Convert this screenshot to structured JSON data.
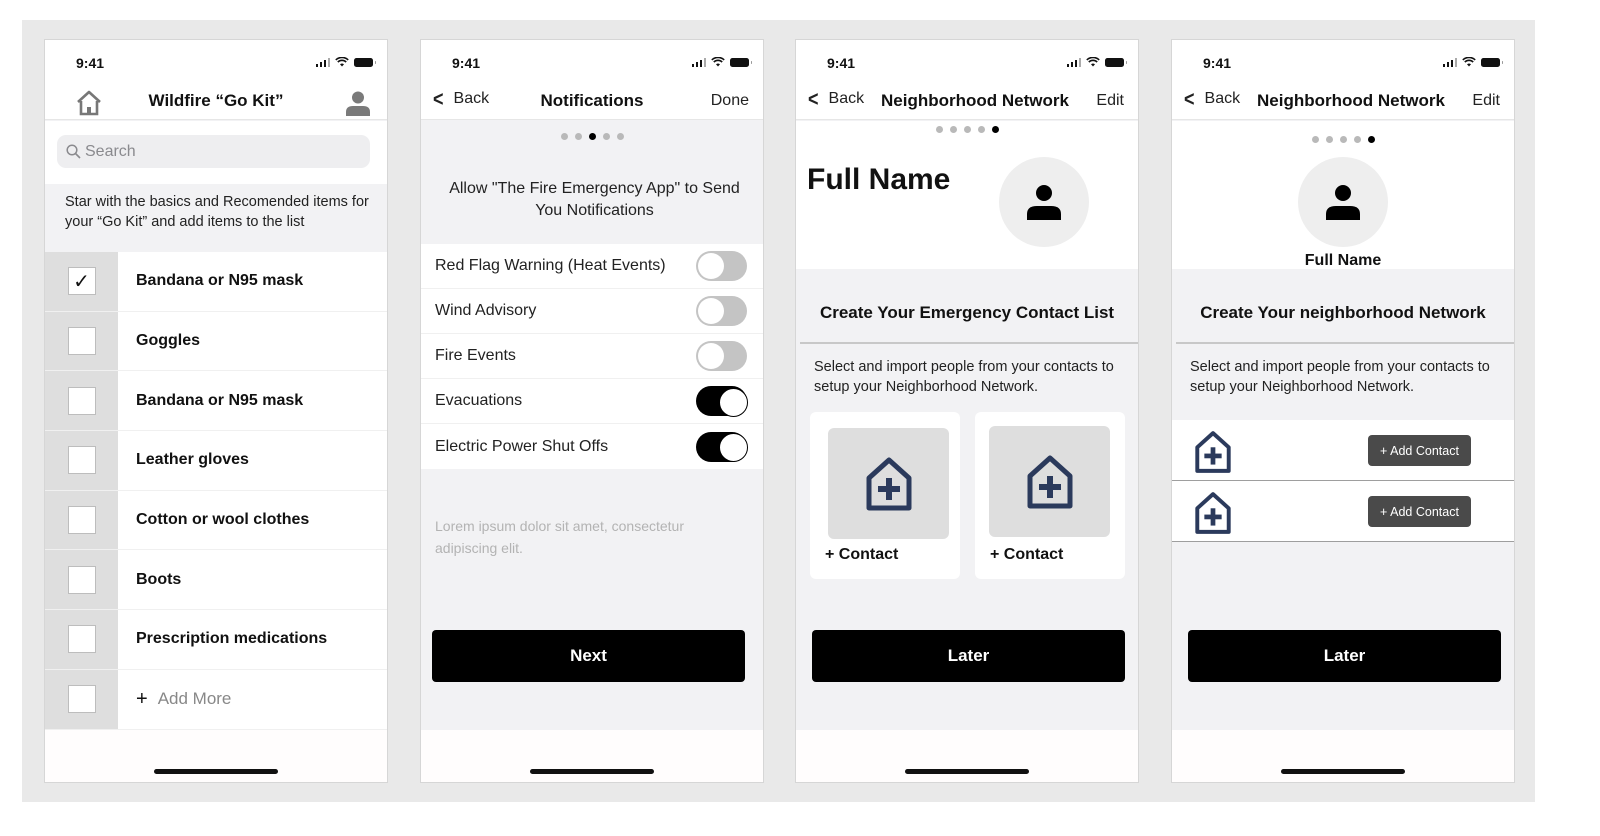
{
  "status_bar": {
    "time": "9:41"
  },
  "screens": {
    "gokit": {
      "title": "Wildfire “Go Kit”",
      "search_placeholder": "Search",
      "intro": "Star with  the basics and Recomended items for your “Go Kit” and add items to the list",
      "items": [
        {
          "label": "Bandana or N95 mask",
          "checked": true
        },
        {
          "label": "Goggles",
          "checked": false
        },
        {
          "label": "Bandana or N95 mask",
          "checked": false
        },
        {
          "label": "Leather gloves",
          "checked": false
        },
        {
          "label": "Cotton or wool clothes",
          "checked": false
        },
        {
          "label": "Boots",
          "checked": false
        },
        {
          "label": "Prescription medications",
          "checked": false
        }
      ],
      "add_more": "Add More",
      "check_glyph": "✓"
    },
    "notifications": {
      "back": "Back",
      "title": "Notifications",
      "done": "Done",
      "page_indicator": {
        "count": 5,
        "active": 3
      },
      "prompt": "Allow \"The Fire Emergency App\" to Send You Notifications",
      "toggles": [
        {
          "label": "Red Flag Warning (Heat Events)",
          "on": false
        },
        {
          "label": "Wind Advisory",
          "on": false
        },
        {
          "label": "Fire Events",
          "on": false
        },
        {
          "label": "Evacuations",
          "on": true
        },
        {
          "label": "Electric Power Shut Offs",
          "on": true
        }
      ],
      "lorem": "Lorem ipsum dolor sit amet, consectetur adipiscing elit.",
      "next": "Next"
    },
    "emergency_contacts": {
      "back": "Back",
      "title": "Neighborhood Network",
      "edit": "Edit",
      "page_indicator": {
        "count": 5,
        "active": 5
      },
      "full_name": "Full Name",
      "section_title": "Create Your Emergency Contact List",
      "description": "Select and import people from your contacts to setup your Neighborhood Network.",
      "cards": [
        {
          "label": "+ Contact"
        },
        {
          "label": "+ Contact"
        }
      ],
      "later": "Later"
    },
    "neighborhood_network": {
      "back": "Back",
      "title": "Neighborhood Network",
      "edit": "Edit",
      "page_indicator": {
        "count": 5,
        "active": 5
      },
      "full_name": "Full Name",
      "section_title": "Create Your neighborhood Network",
      "description": "Select and import people from your contacts to setup your Neighborhood Network.",
      "rows": [
        {
          "button": "+ Add Contact"
        },
        {
          "button": "+ Add Contact"
        }
      ],
      "later": "Later"
    }
  },
  "colors": {
    "icon_navy": "#2b3a5c",
    "button_black": "#000000",
    "add_contact_gray": "#4a4a4a",
    "checkbox_cell": "#dedede",
    "screen_bg": "#f2f2f4"
  }
}
